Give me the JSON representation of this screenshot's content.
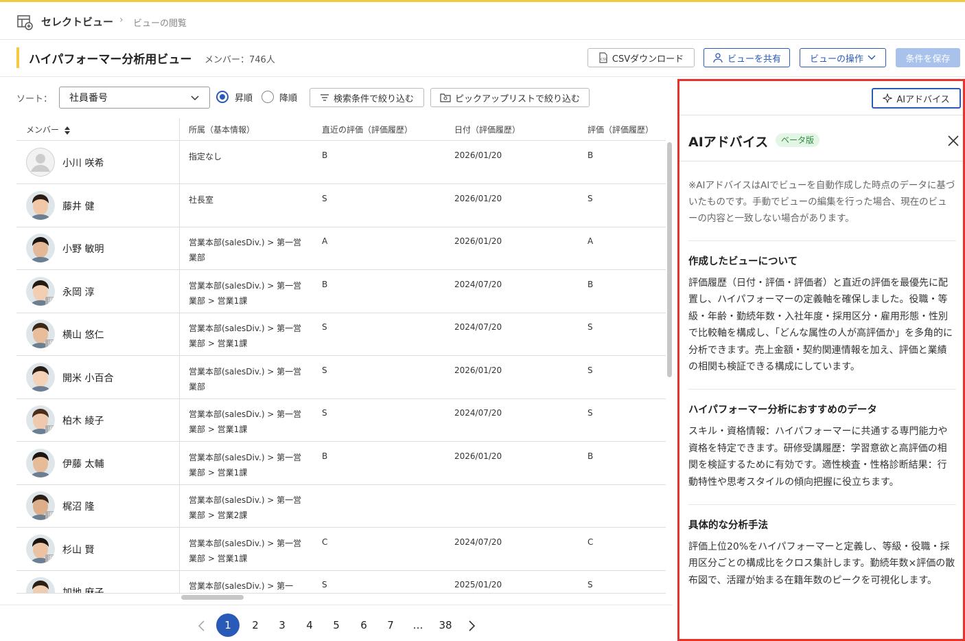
{
  "breadcrumb": {
    "main": "セレクトビュー",
    "separator": ">",
    "sub": "ビューの閲覧"
  },
  "title": {
    "view_name": "ハイパフォーマー分析用ビュー",
    "members": "メンバー：746人"
  },
  "actions": {
    "csv": "CSVダウンロード",
    "share": "ビューを共有",
    "operate": "ビューの操作",
    "save": "条件を保存"
  },
  "toolbar": {
    "sort_label": "ソート：",
    "sort_value": "社員番号",
    "asc": "昇順",
    "desc": "降順",
    "sort_order": "asc",
    "filter_search": "検索条件で絞り込む",
    "filter_pickup": "ピックアップリストで絞り込む"
  },
  "table": {
    "headers": [
      "メンバー",
      "所属（基本情報）",
      "直近の評価（評価履歴）",
      "日付（評価履歴）",
      "評価（評価履歴）"
    ],
    "rows": [
      {
        "name": "小川 咲希",
        "dept": "指定なし",
        "recent": "B",
        "date": "2026/01/20",
        "grade": "B",
        "avatar": "placeholder",
        "retired": false
      },
      {
        "name": "藤井 健",
        "dept": "社長室",
        "recent": "S",
        "date": "2026/01/20",
        "grade": "S",
        "avatar": "photo",
        "retired": false
      },
      {
        "name": "小野 敏明",
        "dept": "営業本部(salesDiv.) > 第一営業部",
        "recent": "A",
        "date": "2026/01/20",
        "grade": "A",
        "avatar": "photo",
        "retired": false
      },
      {
        "name": "永岡 淳",
        "dept": "営業本部(salesDiv.) > 第一営業部 > 営業1課",
        "recent": "B",
        "date": "2024/07/20",
        "grade": "B",
        "avatar": "photo",
        "retired": true
      },
      {
        "name": "横山 悠仁",
        "dept": "営業本部(salesDiv.) > 第一営業部 > 営業1課",
        "recent": "S",
        "date": "2024/07/20",
        "grade": "S",
        "avatar": "photo",
        "retired": true
      },
      {
        "name": "開米 小百合",
        "dept": "営業本部(salesDiv.) > 第一営業部",
        "recent": "S",
        "date": "2026/01/20",
        "grade": "S",
        "avatar": "photo",
        "retired": false
      },
      {
        "name": "柏木 綾子",
        "dept": "営業本部(salesDiv.) > 第一営業部 > 営業1課",
        "recent": "S",
        "date": "2024/07/20",
        "grade": "S",
        "avatar": "photo",
        "retired": true
      },
      {
        "name": "伊藤 太輔",
        "dept": "営業本部(salesDiv.) > 第一営業部 > 営業1課",
        "recent": "B",
        "date": "2026/01/20",
        "grade": "B",
        "avatar": "photo",
        "retired": false
      },
      {
        "name": "梶沼 隆",
        "dept": "営業本部(salesDiv.) > 第一営業部 > 営業2課",
        "recent": "",
        "date": "",
        "grade": "",
        "avatar": "photo",
        "retired": true
      },
      {
        "name": "杉山 賢",
        "dept": "営業本部(salesDiv.) > 第一営業部 > 営業1課",
        "recent": "C",
        "date": "2024/07/20",
        "grade": "C",
        "avatar": "photo",
        "retired": true
      },
      {
        "name": "加地 麻子",
        "dept": "営業本部(salesDiv.) > 第一",
        "recent": "S",
        "date": "2025/01/20",
        "grade": "S",
        "avatar": "photo",
        "retired": false
      }
    ],
    "retired_badge": "退"
  },
  "pagination": {
    "pages": [
      "1",
      "2",
      "3",
      "4",
      "5",
      "6",
      "7",
      "…",
      "38"
    ],
    "current": "1"
  },
  "ai_panel": {
    "button": "AIアドバイス",
    "title": "AIアドバイス",
    "badge": "ベータ版",
    "note": "※AIアドバイスはAIでビューを自動作成した時点のデータに基づいたものです。手動でビューの編集を行った場合、現在のビューの内容と一致しない場合があります。",
    "sections": [
      {
        "title": "作成したビューについて",
        "text": "評価履歴（日付・評価・評価者）と直近の評価を最優先に配置し、ハイパフォーマーの定義軸を確保しました。役職・等級・年齢・勤続年数・入社年度・採用区分・雇用形態・性別で比較軸を構成し、「どんな属性の人が高評価か」を多角的に分析できます。売上金額・契約関連情報を加え、評価と業績の相関も検証できる構成にしています。"
      },
      {
        "title": "ハイパフォーマー分析におすすめのデータ",
        "text": "スキル・資格情報：ハイパフォーマーに共通する専門能力や資格を特定できます。研修受講履歴：学習意欲と高評価の相関を検証するために有効です。適性検査・性格診断結果：行動特性や思考スタイルの傾向把握に役立ちます。"
      },
      {
        "title": "具体的な分析手法",
        "text": "評価上位20%をハイパフォーマーと定義し、等級・役職・採用区分ごとの構成比をクロス集計します。勤続年数×評価の散布図で、活躍が始まる在籍年数のピークを可視化します。"
      }
    ]
  },
  "colors": {
    "accent": "#f5c842",
    "primary": "#2a5ab8",
    "highlight_border": "#e8322a"
  }
}
